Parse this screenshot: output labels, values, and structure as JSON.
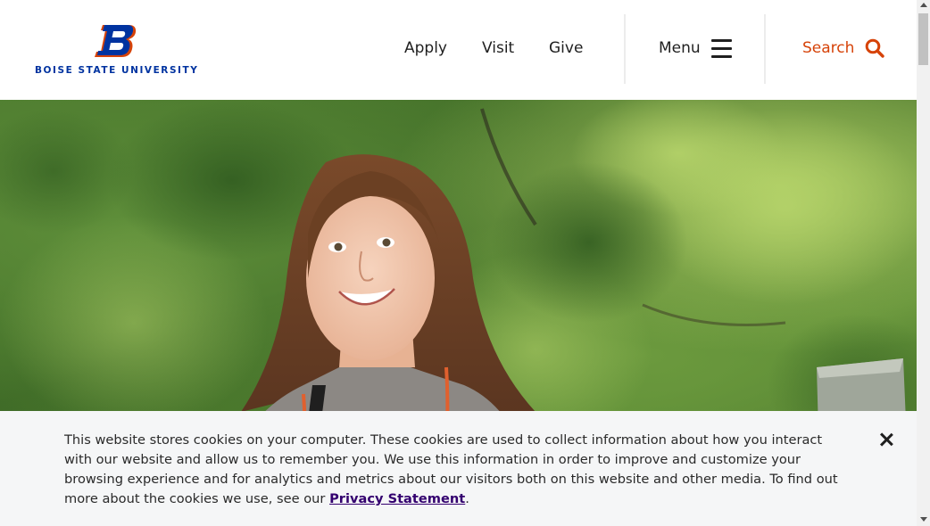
{
  "header": {
    "logo_alt": "Boise State University",
    "logo_text": "BOISE STATE UNIVERSITY",
    "nav": [
      {
        "label": "Apply"
      },
      {
        "label": "Visit"
      },
      {
        "label": "Give"
      }
    ],
    "menu_label": "Menu",
    "search_label": "Search"
  },
  "hero": {
    "image_alt": "Smiling student standing outdoors in front of green trees"
  },
  "cookie_banner": {
    "text": "This website stores cookies on your computer. These cookies are used to collect information about how you interact with our website and allow us to remember you. We use this information in order to improve and customize your browsing experience and for analytics and metrics about our visitors both on this website and other media. To find out more about the cookies we use, see our ",
    "link_label": "Privacy Statement",
    "text_end": "."
  },
  "colors": {
    "brand_blue": "#0033a0",
    "brand_orange": "#d64309",
    "link_purple": "#33006f"
  }
}
